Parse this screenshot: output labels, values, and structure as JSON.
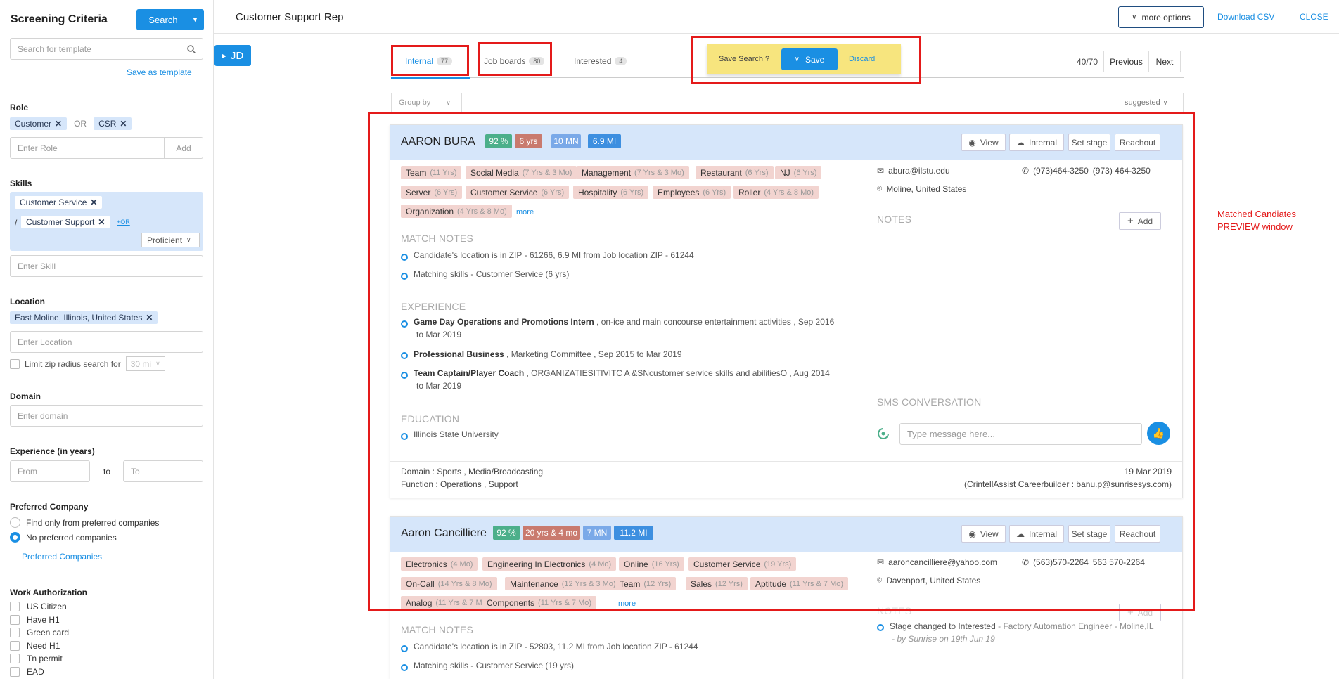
{
  "sidebar": {
    "title": "Screening Criteria",
    "search_button": "Search",
    "template_placeholder": "Search for template",
    "save_template_link": "Save as template",
    "role": {
      "label": "Role",
      "chips": [
        "Customer",
        "CSR"
      ],
      "or_text": "OR",
      "placeholder": "Enter Role",
      "add_button": "Add"
    },
    "skills": {
      "label": "Skills",
      "chip1": "Customer Service",
      "sep": "/",
      "chip2": "Customer Support",
      "or_link": "+OR",
      "level": "Proficient",
      "placeholder": "Enter Skill"
    },
    "location": {
      "label": "Location",
      "chip": "East Moline, Illinois, United States",
      "placeholder": "Enter Location",
      "limit_label": "Limit zip radius search for",
      "radius": "30 mi"
    },
    "domain": {
      "label": "Domain",
      "placeholder": "Enter domain"
    },
    "experience": {
      "label": "Experience (in years)",
      "from_placeholder": "From",
      "to_text": "to",
      "to_placeholder": "To"
    },
    "preferred_company": {
      "label": "Preferred Company",
      "option1": "Find only from preferred companies",
      "option2": "No preferred companies",
      "link": "Preferred Companies"
    },
    "work_auth": {
      "label": "Work Authorization",
      "options": [
        "US Citizen",
        "Have H1",
        "Green card",
        "Need H1",
        "Tn permit",
        "EAD"
      ]
    }
  },
  "header": {
    "title": "Customer Support Rep",
    "more_options": "more options",
    "download_csv": "Download CSV",
    "close": "CLOSE"
  },
  "jd_button": "JD",
  "tabs": [
    {
      "label": "Internal",
      "count": "77"
    },
    {
      "label": "Job boards",
      "count": "80"
    },
    {
      "label": "Interested",
      "count": "4"
    }
  ],
  "save_search": {
    "prompt": "Save Search ?",
    "save": "Save",
    "discard": "Discard"
  },
  "pagination": {
    "range": "40/70",
    "previous": "Previous",
    "next": "Next"
  },
  "group_by": "Group by",
  "sort": "suggested",
  "annotation": {
    "line1": "Matched Candiates",
    "line2": "PREVIEW window"
  },
  "colors": {
    "accent": "#1a8fe3",
    "annotation_red": "#e41a1a",
    "header_blue": "#d6e6fa",
    "skill_pink": "#f2d4d0"
  },
  "candidates": [
    {
      "name": "AARON BURA",
      "badges": [
        "92 %",
        "6 yrs",
        "10 MN",
        "6.9 MI"
      ],
      "actions": {
        "view": "View",
        "internal": "Internal",
        "set_stage": "Set stage",
        "reachout": "Reachout"
      },
      "skills": [
        {
          "name": "Team",
          "yrs": "(11 Yrs)"
        },
        {
          "name": "Social Media",
          "yrs": "(7 Yrs & 3 Mo)"
        },
        {
          "name": "Management",
          "yrs": "(7 Yrs & 3 Mo)"
        },
        {
          "name": "Restaurant",
          "yrs": "(6 Yrs)"
        },
        {
          "name": "NJ",
          "yrs": "(6 Yrs)"
        },
        {
          "name": "Server",
          "yrs": "(6 Yrs)"
        },
        {
          "name": "Customer Service",
          "yrs": "(6 Yrs)"
        },
        {
          "name": "Hospitality",
          "yrs": "(6 Yrs)"
        },
        {
          "name": "Employees",
          "yrs": "(6 Yrs)"
        },
        {
          "name": "Roller",
          "yrs": "(4 Yrs & 8 Mo)"
        },
        {
          "name": "Organization",
          "yrs": "(4 Yrs & 8 Mo)"
        }
      ],
      "more": "more",
      "email": "abura@ilstu.edu",
      "phone1": "(973)464-3250",
      "phone2": "(973) 464-3250",
      "location": "Moline, United States",
      "notes_label": "NOTES",
      "add_note": "Add",
      "match_notes_label": "MATCH NOTES",
      "match_notes": [
        "Candidate's location is in ZIP - 61266, 6.9 MI from Job location ZIP - 61244",
        "Matching skills - Customer Service (6 yrs)"
      ],
      "experience_label": "EXPERIENCE",
      "experience": [
        {
          "title": "Game Day Operations and Promotions Intern",
          "rest": " , on-ice and main concourse entertainment activities , Sep 2016",
          "rest2": "to Mar 2019"
        },
        {
          "title": "Professional Business",
          "rest": " , Marketing Committee , Sep 2015 to Mar 2019",
          "rest2": ""
        },
        {
          "title": "Team Captain/Player Coach",
          "rest": " , ORGANIZATIESITIVITC A &SNcustomer service skills and abilitiesO , Aug 2014",
          "rest2": "to Mar 2019"
        }
      ],
      "education_label": "EDUCATION",
      "education": "Illinois State University",
      "sms_label": "SMS CONVERSATION",
      "sms_placeholder": "Type message here...",
      "domain_line": "Domain : Sports , Media/Broadcasting",
      "function_line": "Function : Operations , Support",
      "date": "19 Mar 2019",
      "source": "(CrintellAssist Careerbuilder : banu.p@sunrisesys.com)"
    },
    {
      "name": "Aaron Cancilliere",
      "badges": [
        "92 %",
        "20 yrs & 4 mo",
        "7 MN",
        "11.2 MI"
      ],
      "actions": {
        "view": "View",
        "internal": "Internal",
        "set_stage": "Set stage",
        "reachout": "Reachout"
      },
      "skills": [
        {
          "name": "Electronics",
          "yrs": "(4 Mo)"
        },
        {
          "name": "Engineering In Electronics",
          "yrs": "(4 Mo)"
        },
        {
          "name": "Online",
          "yrs": "(16 Yrs)"
        },
        {
          "name": "Customer Service",
          "yrs": "(19 Yrs)"
        },
        {
          "name": "On-Call",
          "yrs": "(14 Yrs & 8 Mo)"
        },
        {
          "name": "Maintenance",
          "yrs": "(12 Yrs & 3 Mo)"
        },
        {
          "name": "Team",
          "yrs": "(12 Yrs)"
        },
        {
          "name": "Sales",
          "yrs": "(12 Yrs)"
        },
        {
          "name": "Aptitude",
          "yrs": "(11 Yrs & 7 Mo)"
        },
        {
          "name": "Analog",
          "yrs": "(11 Yrs & 7 Mo)"
        },
        {
          "name": "Components",
          "yrs": "(11 Yrs & 7 Mo)"
        }
      ],
      "more": "more",
      "email": "aaroncancilliere@yahoo.com",
      "phone1": "(563)570-2264",
      "phone2": "563 570-2264",
      "location": "Davenport, United States",
      "notes_label": "NOTES",
      "add_note": "Add",
      "stage_note": "Stage changed to Interested",
      "stage_note_rest": " - Factory Automation Engineer - Moline,IL",
      "stage_by": "- by Sunrise on 19th Jun 19",
      "match_notes_label": "MATCH NOTES",
      "match_notes": [
        "Candidate's location is in ZIP - 52803, 11.2 MI from Job location ZIP - 61244",
        "Matching skills - Customer Service (19 yrs)"
      ]
    }
  ]
}
